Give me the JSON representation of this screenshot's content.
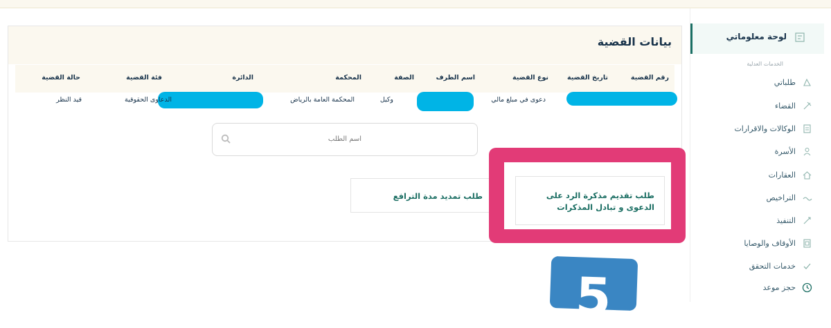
{
  "sidebar": {
    "dashboard_label": "لوحة معلوماتي",
    "section_label": "الخدمات العدلية",
    "items": [
      {
        "label": "طلباتي",
        "icon": "requests-icon"
      },
      {
        "label": "القضاء",
        "icon": "judiciary-icon"
      },
      {
        "label": "الوكالات والاقرارات",
        "icon": "documents-icon"
      },
      {
        "label": "الأسرة",
        "icon": "family-icon"
      },
      {
        "label": "العقارات",
        "icon": "real-estate-icon"
      },
      {
        "label": "التراخيص",
        "icon": "licenses-icon"
      },
      {
        "label": "التنفيذ",
        "icon": "execution-icon"
      },
      {
        "label": "الأوقاف والوصايا",
        "icon": "endowments-icon"
      },
      {
        "label": "خدمات التحقق",
        "icon": "verification-icon"
      },
      {
        "label": "حجز موعد",
        "icon": "clock-icon"
      }
    ]
  },
  "case": {
    "title": "بيانات القضية",
    "headers": {
      "case_number": "رقم القضية",
      "case_date": "تاريخ القضية",
      "case_type": "نوع القضية",
      "party_name": "اسم الطرف",
      "role": "الصفة",
      "court": "المحكمة",
      "circuit": "الدائرة",
      "category": "فئة القضية",
      "status": "حالة القضية"
    },
    "row": {
      "case_type": "دعوى في مبلغ مالي",
      "role": "وكيل",
      "court": "المحكمة العامة بالرياض",
      "category": "الدعاوى الحقوقية",
      "status": "قيد النظر"
    }
  },
  "search": {
    "placeholder": "اسم الطلب"
  },
  "requests": [
    {
      "label": "طلب تقديم مذكرة الرد على الدعوى و تبادل المذكرات"
    },
    {
      "label": "طلب تمديد مدة الترافع"
    }
  ],
  "step_badge": {
    "value": "5"
  },
  "colors": {
    "accent": "#1b6e63",
    "highlight": "#e23b77",
    "redaction": "#00b4e6",
    "badge": "#3a86c3"
  }
}
